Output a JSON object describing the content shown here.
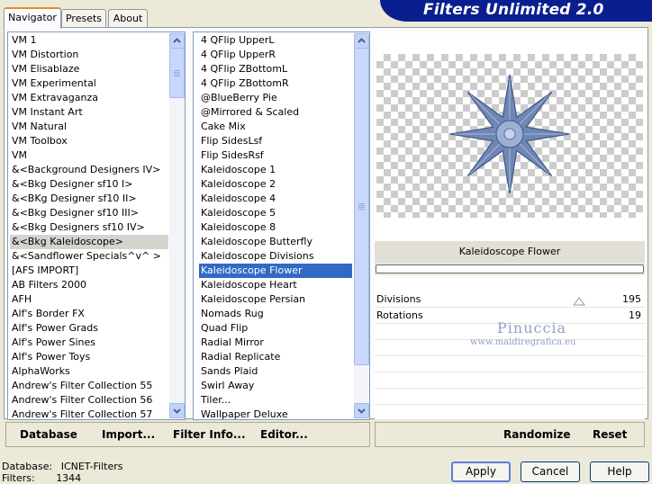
{
  "tabs": [
    {
      "label": "Navigator"
    },
    {
      "label": "Presets"
    },
    {
      "label": "About"
    }
  ],
  "app_title": "Filters Unlimited 2.0",
  "categories": [
    "VM 1",
    "VM Distortion",
    "VM Elisablaze",
    "VM Experimental",
    "VM Extravaganza",
    "VM Instant Art",
    "VM Natural",
    "VM Toolbox",
    "VM",
    "&<Background Designers IV>",
    "&<Bkg Designer sf10 I>",
    "&<BKg Designer sf10 II>",
    "&<Bkg Designer sf10 III>",
    "&<Bkg Designers sf10 IV>",
    "&<Bkg Kaleidoscope>",
    "&<Sandflower Specials^v^ >",
    "[AFS IMPORT]",
    "AB Filters 2000",
    "AFH",
    "Alf's Border FX",
    "Alf's Power Grads",
    "Alf's Power Sines",
    "Alf's Power Toys",
    "AlphaWorks",
    "Andrew's Filter Collection 55",
    "Andrew's Filter Collection 56",
    "Andrew's Filter Collection 57"
  ],
  "selected_category": "&<Bkg Kaleidoscope>",
  "filters": [
    "4 QFlip UpperL",
    "4 QFlip UpperR",
    "4 QFlip ZBottomL",
    "4 QFlip ZBottomR",
    "@BlueBerry Pie",
    "@Mirrored & Scaled",
    "Cake Mix",
    "Flip SidesLsf",
    "Flip SidesRsf",
    "Kaleidoscope 1",
    "Kaleidoscope 2",
    "Kaleidoscope 4",
    "Kaleidoscope 5",
    "Kaleidoscope 8",
    "Kaleidoscope Butterfly",
    "Kaleidoscope Divisions",
    "Kaleidoscope Flower",
    "Kaleidoscope Heart",
    "Kaleidoscope Persian",
    "Nomads Rug",
    "Quad Flip",
    "Radial Mirror",
    "Radial Replicate",
    "Sands Plaid",
    "Swirl Away",
    "Tiler...",
    "Wallpaper Deluxe"
  ],
  "selected_filter": "Kaleidoscope Flower",
  "preview": {
    "filter_name": "Kaleidoscope Flower",
    "watermark_name": "Pinuccia",
    "watermark_url": "www.maidiregrafica.eu"
  },
  "params": [
    {
      "label": "Divisions",
      "value": "195"
    },
    {
      "label": "Rotations",
      "value": "19"
    }
  ],
  "toolbar": {
    "database": "Database",
    "import": "Import...",
    "filter_info": "Filter Info...",
    "editor": "Editor...",
    "randomize": "Randomize",
    "reset": "Reset"
  },
  "status": {
    "database_label": "Database:",
    "database_value": "ICNET-Filters",
    "filters_label": "Filters:",
    "filters_value": "1344"
  },
  "buttons": {
    "apply": "Apply",
    "cancel": "Cancel",
    "help": "Help"
  },
  "colors": {
    "banner": "#0a1f8f",
    "selection": "#316ac5",
    "flower": "#6f87b5"
  }
}
